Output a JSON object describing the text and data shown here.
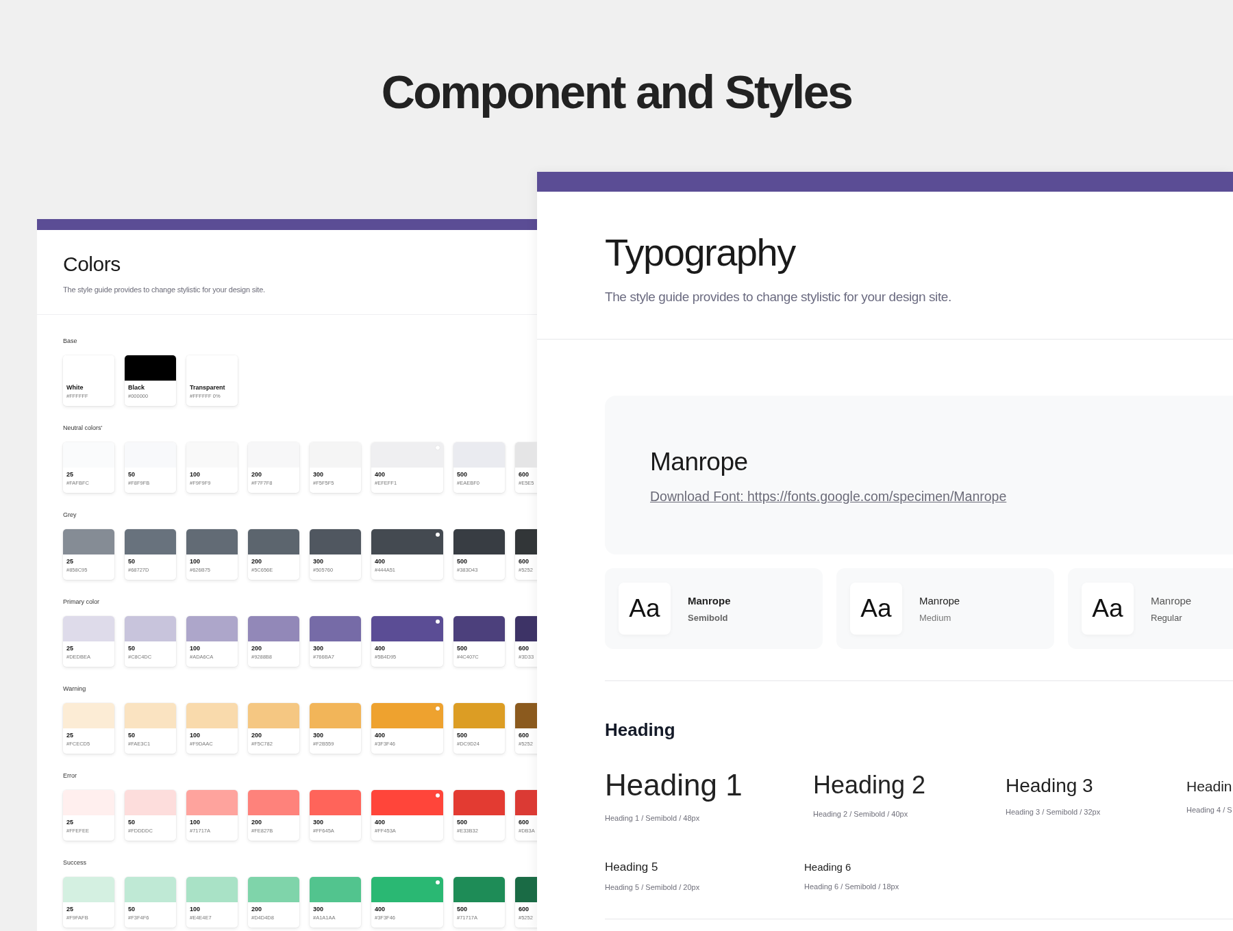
{
  "title": "Component and Styles",
  "colors_panel": {
    "title": "Colors",
    "subtitle": "The style guide provides to change stylistic for your design site.",
    "groups": [
      {
        "label": "Base",
        "swatches": [
          {
            "name": "White",
            "hex": "#FFFFFF",
            "color": "#ffffff",
            "selected": false
          },
          {
            "name": "Black",
            "hex": "#000000",
            "color": "#000000",
            "selected": false
          },
          {
            "name": "Transparent",
            "hex": "#FFFFFF 0%",
            "color": "#ffffff",
            "selected": false
          }
        ]
      },
      {
        "label": "Neutral colors'",
        "swatches": [
          {
            "name": "25",
            "hex": "#FAFBFC",
            "color": "#fafbfc",
            "selected": false
          },
          {
            "name": "50",
            "hex": "#F8F9FB",
            "color": "#f8f9fb",
            "selected": false
          },
          {
            "name": "100",
            "hex": "#F9F9F9",
            "color": "#f9f9f9",
            "selected": false
          },
          {
            "name": "200",
            "hex": "#F7F7F8",
            "color": "#f7f7f8",
            "selected": false
          },
          {
            "name": "300",
            "hex": "#F5F5F5",
            "color": "#f5f5f5",
            "selected": false
          },
          {
            "name": "400",
            "hex": "#EFEFF1",
            "color": "#efeff1",
            "selected": true
          },
          {
            "name": "500",
            "hex": "#EAEBF0",
            "color": "#eaebf0",
            "selected": false
          },
          {
            "name": "600",
            "hex": "#E5E5",
            "color": "#e5e5e6",
            "selected": false
          }
        ]
      },
      {
        "label": "Grey",
        "swatches": [
          {
            "name": "25",
            "hex": "#858C95",
            "color": "#858c95",
            "selected": false
          },
          {
            "name": "50",
            "hex": "#68727D",
            "color": "#68727d",
            "selected": false
          },
          {
            "name": "100",
            "hex": "#626B75",
            "color": "#626b75",
            "selected": false
          },
          {
            "name": "200",
            "hex": "#5C656E",
            "color": "#5c656e",
            "selected": false
          },
          {
            "name": "300",
            "hex": "#505760",
            "color": "#505760",
            "selected": false
          },
          {
            "name": "400",
            "hex": "#444A51",
            "color": "#444a51",
            "selected": true
          },
          {
            "name": "500",
            "hex": "#383D43",
            "color": "#383d43",
            "selected": false
          },
          {
            "name": "600",
            "hex": "#5252",
            "color": "#323638",
            "selected": false
          }
        ]
      },
      {
        "label": "Primary color",
        "swatches": [
          {
            "name": "25",
            "hex": "#DEDBEA",
            "color": "#dedbea",
            "selected": false
          },
          {
            "name": "50",
            "hex": "#C8C4DC",
            "color": "#c8c4dc",
            "selected": false
          },
          {
            "name": "100",
            "hex": "#ADA6CA",
            "color": "#ada6ca",
            "selected": false
          },
          {
            "name": "200",
            "hex": "#9288B8",
            "color": "#9288b8",
            "selected": false
          },
          {
            "name": "300",
            "hex": "#766BA7",
            "color": "#766ba7",
            "selected": false
          },
          {
            "name": "400",
            "hex": "#5B4D95",
            "color": "#5b4d95",
            "selected": true
          },
          {
            "name": "500",
            "hex": "#4C407C",
            "color": "#4c407c",
            "selected": false
          },
          {
            "name": "600",
            "hex": "#3D33",
            "color": "#3d3366",
            "selected": false
          }
        ]
      },
      {
        "label": "Warning",
        "swatches": [
          {
            "name": "25",
            "hex": "#FCECD5",
            "color": "#fcecd5",
            "selected": false
          },
          {
            "name": "50",
            "hex": "#FAE3C1",
            "color": "#fae3c1",
            "selected": false
          },
          {
            "name": "100",
            "hex": "#F9DAAC",
            "color": "#f9daac",
            "selected": false
          },
          {
            "name": "200",
            "hex": "#F5C782",
            "color": "#f5c782",
            "selected": false
          },
          {
            "name": "300",
            "hex": "#F2B559",
            "color": "#f2b559",
            "selected": false
          },
          {
            "name": "400",
            "hex": "#3F3F46",
            "color": "#eea22f",
            "selected": true
          },
          {
            "name": "500",
            "hex": "#DC9D24",
            "color": "#dc9d24",
            "selected": false
          },
          {
            "name": "600",
            "hex": "#5252",
            "color": "#8b5a1e",
            "selected": false
          }
        ]
      },
      {
        "label": "Error",
        "swatches": [
          {
            "name": "25",
            "hex": "#FFEFEE",
            "color": "#ffefee",
            "selected": false
          },
          {
            "name": "50",
            "hex": "#FDDDDC",
            "color": "#fddddc",
            "selected": false
          },
          {
            "name": "100",
            "hex": "#71717A",
            "color": "#fea39d",
            "selected": false
          },
          {
            "name": "200",
            "hex": "#FE827B",
            "color": "#fe827b",
            "selected": false
          },
          {
            "name": "300",
            "hex": "#FF645A",
            "color": "#ff645a",
            "selected": false
          },
          {
            "name": "400",
            "hex": "#FF453A",
            "color": "#ff453a",
            "selected": true
          },
          {
            "name": "500",
            "hex": "#E33B32",
            "color": "#e33b32",
            "selected": false
          },
          {
            "name": "600",
            "hex": "#DB3A",
            "color": "#db3a34",
            "selected": false
          }
        ]
      },
      {
        "label": "Success",
        "swatches": [
          {
            "name": "25",
            "hex": "#F9FAFB",
            "color": "#d4f0e1",
            "selected": false
          },
          {
            "name": "50",
            "hex": "#F3F4F6",
            "color": "#bfe9d5",
            "selected": false
          },
          {
            "name": "100",
            "hex": "#E4E4E7",
            "color": "#a9e2c6",
            "selected": false
          },
          {
            "name": "200",
            "hex": "#D4D4D8",
            "color": "#7fd4aa",
            "selected": false
          },
          {
            "name": "300",
            "hex": "#A1A1AA",
            "color": "#52c48e",
            "selected": false
          },
          {
            "name": "400",
            "hex": "#3F3F46",
            "color": "#2ab873",
            "selected": true
          },
          {
            "name": "500",
            "hex": "#71717A",
            "color": "#1e8c57",
            "selected": false
          },
          {
            "name": "600",
            "hex": "#5252",
            "color": "#1a6b45",
            "selected": false
          }
        ]
      }
    ]
  },
  "typography_panel": {
    "title": "Typography",
    "subtitle": "The style guide provides to change stylistic for your design site.",
    "font_card": {
      "name": "Manrope",
      "link": "Download Font: https://fonts.google.com/specimen/Manrope"
    },
    "weights": [
      {
        "sample": "Aa",
        "name": "Manrope",
        "weight": "Semibold",
        "kind": "semibold"
      },
      {
        "sample": "Aa",
        "name": "Manrope",
        "weight": "Medium",
        "kind": "medium"
      },
      {
        "sample": "Aa",
        "name": "Manrope",
        "weight": "Regular",
        "kind": "regular"
      }
    ],
    "heading_section": {
      "title": "Heading",
      "headings": [
        {
          "text": "Heading 1",
          "caption": "Heading 1 / Semibold / 48px",
          "kind": "h1"
        },
        {
          "text": "Heading 2",
          "caption": "Heading 2 / Semibold / 40px",
          "kind": "h2"
        },
        {
          "text": "Heading 3",
          "caption": "Heading 3 / Semibold / 32px",
          "kind": "h3"
        },
        {
          "text": "Headin",
          "caption": "Heading 4 / S",
          "kind": "h4"
        },
        {
          "text": "Heading 5",
          "caption": "Heading 5 / Semibold / 20px",
          "kind": "h5"
        },
        {
          "text": "Heading 6",
          "caption": "Heading 6 / Semibold / 18px",
          "kind": "h6"
        }
      ]
    }
  }
}
